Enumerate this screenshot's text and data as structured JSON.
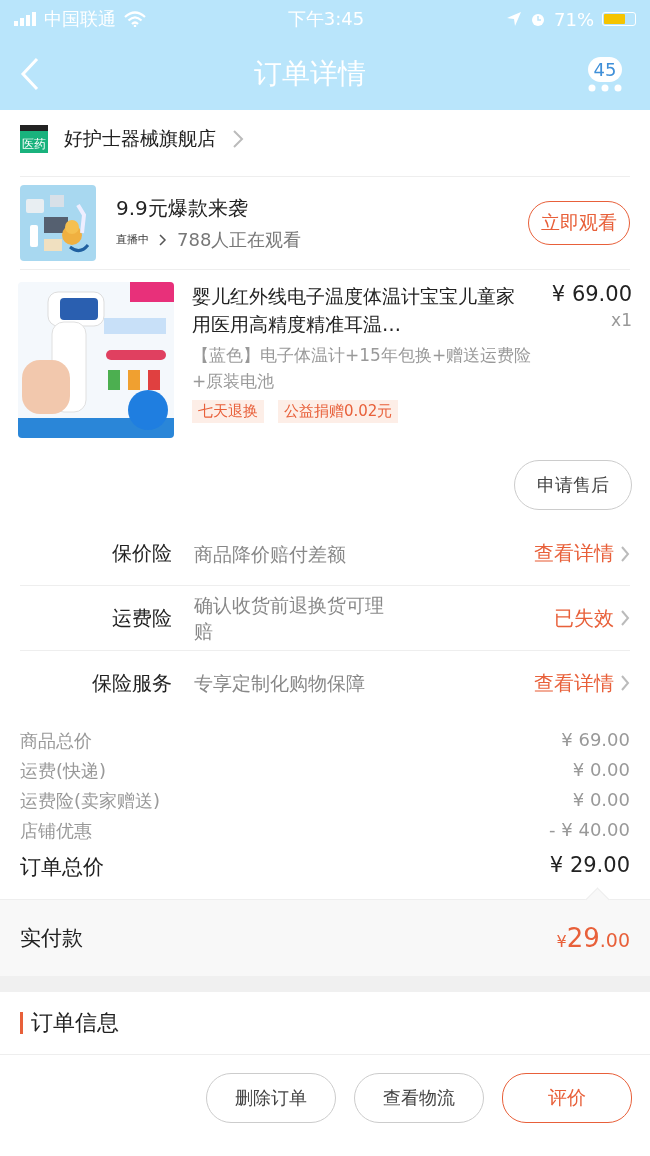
{
  "status_bar": {
    "carrier": "中国联通",
    "time": "下午3:45",
    "battery": "71%"
  },
  "nav": {
    "title": "订单详情",
    "badge": "45"
  },
  "store": {
    "badge": "医药",
    "name": "好护士器械旗舰店"
  },
  "live": {
    "title": "9.9元爆款来袭",
    "state": "直播中",
    "viewers": "788人正在观看",
    "button": "立即观看"
  },
  "product": {
    "title": "婴儿红外线电子温度体温计宝宝儿童家用医用高精度精准耳温…",
    "price": "¥ 69.00",
    "quantity": "x1",
    "spec": "【蓝色】电子体温计+15年包换+赠送运费险+原装电池",
    "tags": [
      "七天退换",
      "公益捐赠0.02元"
    ],
    "button": "申请售后"
  },
  "services": [
    {
      "label": "保价险",
      "desc": "商品降价赔付差额",
      "action": "查看详情"
    },
    {
      "label": "运费险",
      "desc": "确认收货前退换货可理赔",
      "action": "已失效"
    },
    {
      "label": "保险服务",
      "desc": "专享定制化购物保障",
      "action": "查看详情"
    }
  ],
  "costs": [
    {
      "label": "商品总价",
      "value": "¥ 69.00"
    },
    {
      "label": "运费(快递)",
      "value": "¥ 0.00"
    },
    {
      "label": "运费险(卖家赠送)",
      "value": "¥ 0.00"
    },
    {
      "label": "店铺优惠",
      "value": "- ¥ 40.00"
    }
  ],
  "total": {
    "label": "订单总价",
    "value": "¥ 29.00"
  },
  "paid": {
    "label": "实付款",
    "currency": "¥",
    "integer": "29",
    "decimal": ".00"
  },
  "order_info": {
    "title": "订单信息"
  },
  "actions": [
    {
      "label": "删除订单",
      "primary": false
    },
    {
      "label": "查看物流",
      "primary": false
    },
    {
      "label": "评价",
      "primary": true
    }
  ]
}
